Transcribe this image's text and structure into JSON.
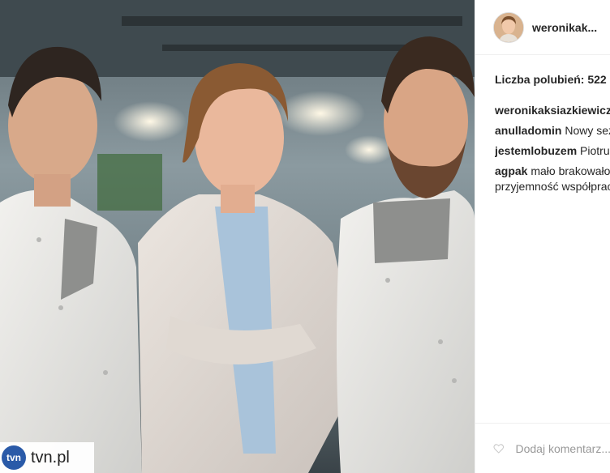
{
  "post": {
    "username": "weronikak...",
    "likes_label": "Liczba polubień: 522",
    "comments": [
      {
        "user": "weronikaksiazkiewicz",
        "text": ""
      },
      {
        "user": "anulladomin",
        "text": "Nowy sezon"
      },
      {
        "user": "jestemlobuzem",
        "text": "Piotrus"
      },
      {
        "user": "agpak",
        "text": "mało brakowało",
        "text2": "przyjemność współpracy"
      }
    ],
    "add_comment_placeholder": "Dodaj komentarz..."
  },
  "watermark": {
    "logo_text": "tvn",
    "site": "tvn.pl"
  },
  "icons": {
    "like": "heart-outline-icon",
    "watermark": "tvn-logo-icon"
  },
  "colors": {
    "username": "#262626",
    "muted": "#999999",
    "tvn_blue": "#2a5aa8"
  }
}
